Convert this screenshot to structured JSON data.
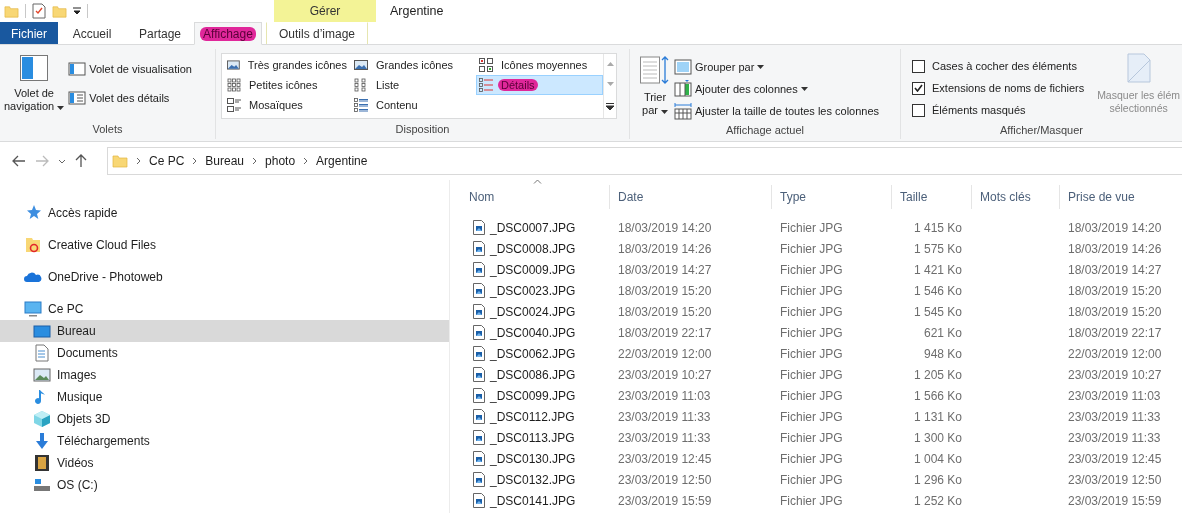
{
  "window": {
    "title": "Argentine"
  },
  "context_tab": {
    "label": "Gérer"
  },
  "tabs": [
    {
      "label": "Fichier",
      "kind": "file",
      "selected": false,
      "highlighted": false
    },
    {
      "label": "Accueil",
      "kind": "normal",
      "selected": false,
      "highlighted": false
    },
    {
      "label": "Partage",
      "kind": "normal",
      "selected": false,
      "highlighted": false
    },
    {
      "label": "Affichage",
      "kind": "normal",
      "selected": true,
      "highlighted": true
    },
    {
      "label": "Outils d’image",
      "kind": "context",
      "selected": false,
      "highlighted": false
    }
  ],
  "ribbon": {
    "panes": {
      "label": "Volets",
      "navigation_button": {
        "lines": [
          "Volet de",
          "navigation"
        ]
      },
      "buttons": [
        {
          "label": "Volet de visualisation",
          "kind": "preview"
        },
        {
          "label": "Volet des détails",
          "kind": "details"
        }
      ]
    },
    "layout": {
      "label": "Disposition",
      "options": [
        {
          "label": "Très grandes icônes",
          "kind": "xl",
          "selected": false,
          "highlighted": false
        },
        {
          "label": "Grandes icônes",
          "kind": "large",
          "selected": false,
          "highlighted": false
        },
        {
          "label": "Icônes moyennes",
          "kind": "medium",
          "selected": false,
          "highlighted": false
        },
        {
          "label": "Petites icônes",
          "kind": "small",
          "selected": false,
          "highlighted": false
        },
        {
          "label": "Liste",
          "kind": "list",
          "selected": false,
          "highlighted": false
        },
        {
          "label": "Détails",
          "kind": "details",
          "selected": true,
          "highlighted": true
        },
        {
          "label": "Mosaïques",
          "kind": "tiles",
          "selected": false,
          "highlighted": false
        },
        {
          "label": "Contenu",
          "kind": "content",
          "selected": false,
          "highlighted": false
        }
      ]
    },
    "current_view": {
      "label": "Affichage actuel",
      "sort_button": {
        "lines": [
          "Trier",
          "par"
        ]
      },
      "buttons": [
        {
          "label": "Grouper par",
          "kind": "group",
          "dropdown": true
        },
        {
          "label": "Ajouter des colonnes",
          "kind": "columns",
          "dropdown": true
        },
        {
          "label": "Ajuster la taille de toutes les colonnes",
          "kind": "fit",
          "dropdown": false
        }
      ]
    },
    "show_hide": {
      "label": "Afficher/Masquer",
      "checkboxes": [
        {
          "label": "Cases à cocher des éléments",
          "checked": false
        },
        {
          "label": "Extensions de noms de fichiers",
          "checked": true
        },
        {
          "label": "Éléments masqués",
          "checked": false
        }
      ],
      "hide_button": {
        "lines": [
          "Masquer les élém",
          "sélectionnés"
        ],
        "disabled": true
      }
    }
  },
  "address": {
    "segments": [
      "Ce PC",
      "Bureau",
      "photo",
      "Argentine"
    ]
  },
  "sidebar": {
    "items": [
      {
        "label": "Accès rapide",
        "kind": "star",
        "selected": false
      },
      {
        "label": "Creative Cloud Files",
        "kind": "cc",
        "selected": false
      },
      {
        "label": "OneDrive - Photoweb",
        "kind": "cloud",
        "selected": false
      },
      {
        "label": "Ce PC",
        "kind": "pc",
        "selected": false,
        "children": [
          {
            "label": "Bureau",
            "kind": "desktop",
            "selected": true
          },
          {
            "label": "Documents",
            "kind": "documents",
            "selected": false
          },
          {
            "label": "Images",
            "kind": "images",
            "selected": false
          },
          {
            "label": "Musique",
            "kind": "music",
            "selected": false
          },
          {
            "label": "Objets 3D",
            "kind": "cube",
            "selected": false
          },
          {
            "label": "Téléchargements",
            "kind": "download",
            "selected": false
          },
          {
            "label": "Vidéos",
            "kind": "video",
            "selected": false
          },
          {
            "label": "OS (C:)",
            "kind": "drive",
            "selected": false
          }
        ]
      }
    ]
  },
  "table": {
    "columns": [
      "Nom",
      "Date",
      "Type",
      "Taille",
      "Mots clés",
      "Prise de vue"
    ],
    "rows": [
      [
        "_DSC0007.JPG",
        "18/03/2019 14:20",
        "Fichier JPG",
        "1 415 Ko",
        "",
        "18/03/2019 14:20"
      ],
      [
        "_DSC0008.JPG",
        "18/03/2019 14:26",
        "Fichier JPG",
        "1 575 Ko",
        "",
        "18/03/2019 14:26"
      ],
      [
        "_DSC0009.JPG",
        "18/03/2019 14:27",
        "Fichier JPG",
        "1 421 Ko",
        "",
        "18/03/2019 14:27"
      ],
      [
        "_DSC0023.JPG",
        "18/03/2019 15:20",
        "Fichier JPG",
        "1 546 Ko",
        "",
        "18/03/2019 15:20"
      ],
      [
        "_DSC0024.JPG",
        "18/03/2019 15:20",
        "Fichier JPG",
        "1 545 Ko",
        "",
        "18/03/2019 15:20"
      ],
      [
        "_DSC0040.JPG",
        "18/03/2019 22:17",
        "Fichier JPG",
        "621 Ko",
        "",
        "18/03/2019 22:17"
      ],
      [
        "_DSC0062.JPG",
        "22/03/2019 12:00",
        "Fichier JPG",
        "948 Ko",
        "",
        "22/03/2019 12:00"
      ],
      [
        "_DSC0086.JPG",
        "23/03/2019 10:27",
        "Fichier JPG",
        "1 205 Ko",
        "",
        "23/03/2019 10:27"
      ],
      [
        "_DSC0099.JPG",
        "23/03/2019 11:03",
        "Fichier JPG",
        "1 566 Ko",
        "",
        "23/03/2019 11:03"
      ],
      [
        "_DSC0112.JPG",
        "23/03/2019 11:33",
        "Fichier JPG",
        "1 131 Ko",
        "",
        "23/03/2019 11:33"
      ],
      [
        "_DSC0113.JPG",
        "23/03/2019 11:33",
        "Fichier JPG",
        "1 300 Ko",
        "",
        "23/03/2019 11:33"
      ],
      [
        "_DSC0130.JPG",
        "23/03/2019 12:45",
        "Fichier JPG",
        "1 004 Ko",
        "",
        "23/03/2019 12:45"
      ],
      [
        "_DSC0132.JPG",
        "23/03/2019 12:50",
        "Fichier JPG",
        "1 296 Ko",
        "",
        "23/03/2019 12:50"
      ],
      [
        "_DSC0141.JPG",
        "23/03/2019 15:59",
        "Fichier JPG",
        "1 252 Ko",
        "",
        "23/03/2019 15:59"
      ]
    ]
  }
}
